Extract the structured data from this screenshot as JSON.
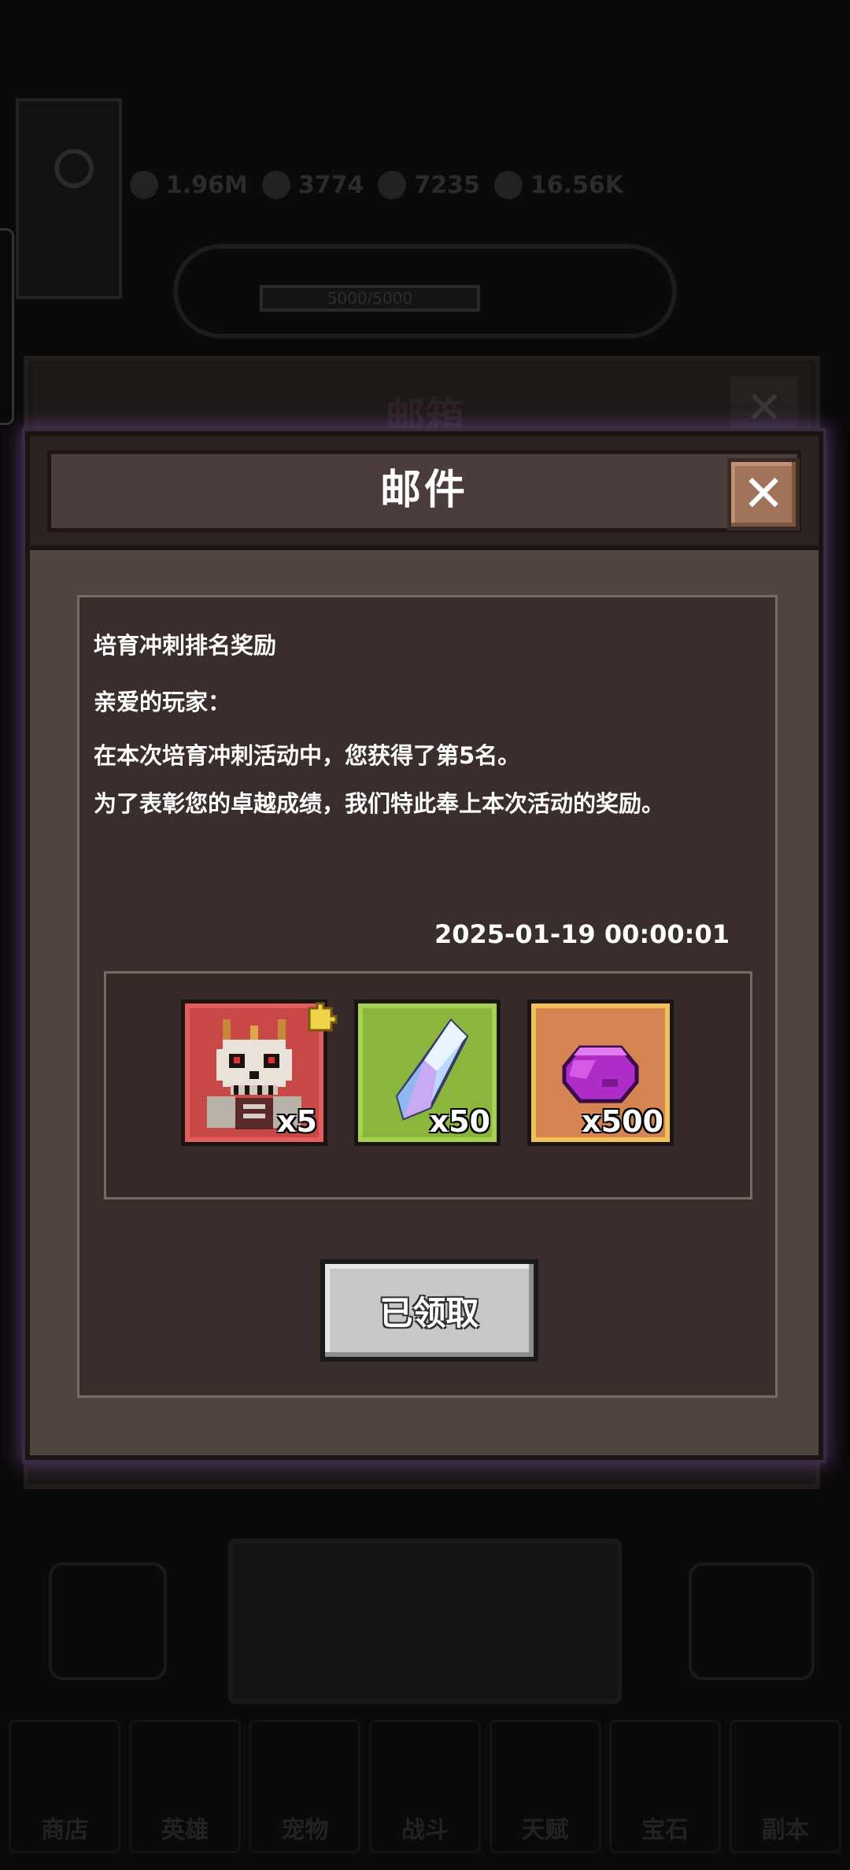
{
  "background": {
    "mailbox_title": "邮箱",
    "mailbox_close": "✕",
    "stats": [
      {
        "label": "1.96M"
      },
      {
        "label": "3774"
      },
      {
        "label": "7235"
      },
      {
        "label": "16.56K"
      }
    ],
    "season_progress": "5000/5000",
    "nav_items": [
      "商店",
      "英雄",
      "宠物",
      "战斗",
      "天赋",
      "宝石",
      "副本"
    ]
  },
  "dialog": {
    "title": "邮件",
    "close_label": "✕"
  },
  "mail": {
    "subject": "培育冲刺排名奖励",
    "greeting": "亲爱的玩家：",
    "line1": "在本次培育冲刺活动中，您获得了第5名。",
    "line2": "为了表彰您的卓越成绩，我们特此奉上本次活动的奖励。",
    "date": "2025-01-19 00:00:01"
  },
  "rewards": [
    {
      "icon": "skull-king-fragment-icon",
      "qty": "x5",
      "color": "#c84848"
    },
    {
      "icon": "crystal-icon",
      "qty": "x50",
      "color": "#8bb63e"
    },
    {
      "icon": "purple-gem-icon",
      "qty": "x500",
      "color": "#d78453"
    }
  ],
  "claim_button": {
    "label": "已领取"
  }
}
